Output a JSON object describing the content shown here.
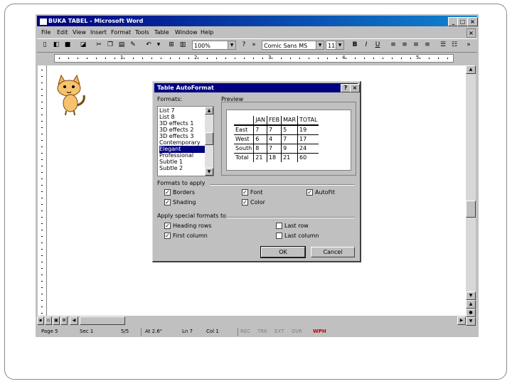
{
  "window": {
    "title": "BUKA TABEL - Microsoft Word",
    "controls": [
      "_",
      "□",
      "×"
    ]
  },
  "menu": {
    "items": [
      "File",
      "Edit",
      "View",
      "Insert",
      "Format",
      "Tools",
      "Table",
      "Window",
      "Help"
    ],
    "doc_close": "×"
  },
  "toolbar": {
    "zoom": "100%",
    "font": "Comic Sans MS",
    "size": "11"
  },
  "ruler": {
    "numbers": [
      "1",
      "2",
      "3",
      "4",
      "5"
    ]
  },
  "dialog": {
    "title": "Table AutoFormat",
    "help_btn": "?",
    "close_btn": "×",
    "formats_label": "Formats:",
    "preview_label": "Preview",
    "formats": [
      "List 7",
      "List 8",
      "3D effects 1",
      "3D effects 2",
      "3D effects 3",
      "Contemporary",
      "Elegant",
      "Professional",
      "Subtle 1",
      "Subtle 2"
    ],
    "selected_format": "Elegant",
    "preview_table": {
      "header": [
        "",
        "JAN",
        "FEB",
        "MAR",
        "TOTAL"
      ],
      "rows": [
        [
          "East",
          "7",
          "7",
          "5",
          "19"
        ],
        [
          "West",
          "6",
          "4",
          "7",
          "17"
        ],
        [
          "South",
          "8",
          "7",
          "9",
          "24"
        ],
        [
          "Total",
          "21",
          "18",
          "21",
          "60"
        ]
      ]
    },
    "formats_to_apply_label": "Formats to apply",
    "apply": [
      {
        "label": "Borders",
        "checked": true
      },
      {
        "label": "Shading",
        "checked": true
      },
      {
        "label": "Font",
        "checked": true
      },
      {
        "label": "Color",
        "checked": true
      },
      {
        "label": "AutoFit",
        "checked": true
      }
    ],
    "special_label": "Apply special formats to",
    "special": [
      {
        "label": "Heading rows",
        "checked": true
      },
      {
        "label": "First column",
        "checked": true
      },
      {
        "label": "Last row",
        "checked": false
      },
      {
        "label": "Last column",
        "checked": false
      }
    ],
    "ok": "OK",
    "cancel": "Cancel"
  },
  "status": {
    "page": "Page 5",
    "sec": "Sec 1",
    "pages": "5/5",
    "at": "At 2.6\"",
    "ln": "Ln 7",
    "col": "Col 1",
    "modes": [
      "REC",
      "TRK",
      "EXT",
      "OVR"
    ],
    "lang": "WPH"
  },
  "colors": {
    "titlebar": "#000080",
    "face": "#c0c0c0",
    "selection": "#000080"
  }
}
